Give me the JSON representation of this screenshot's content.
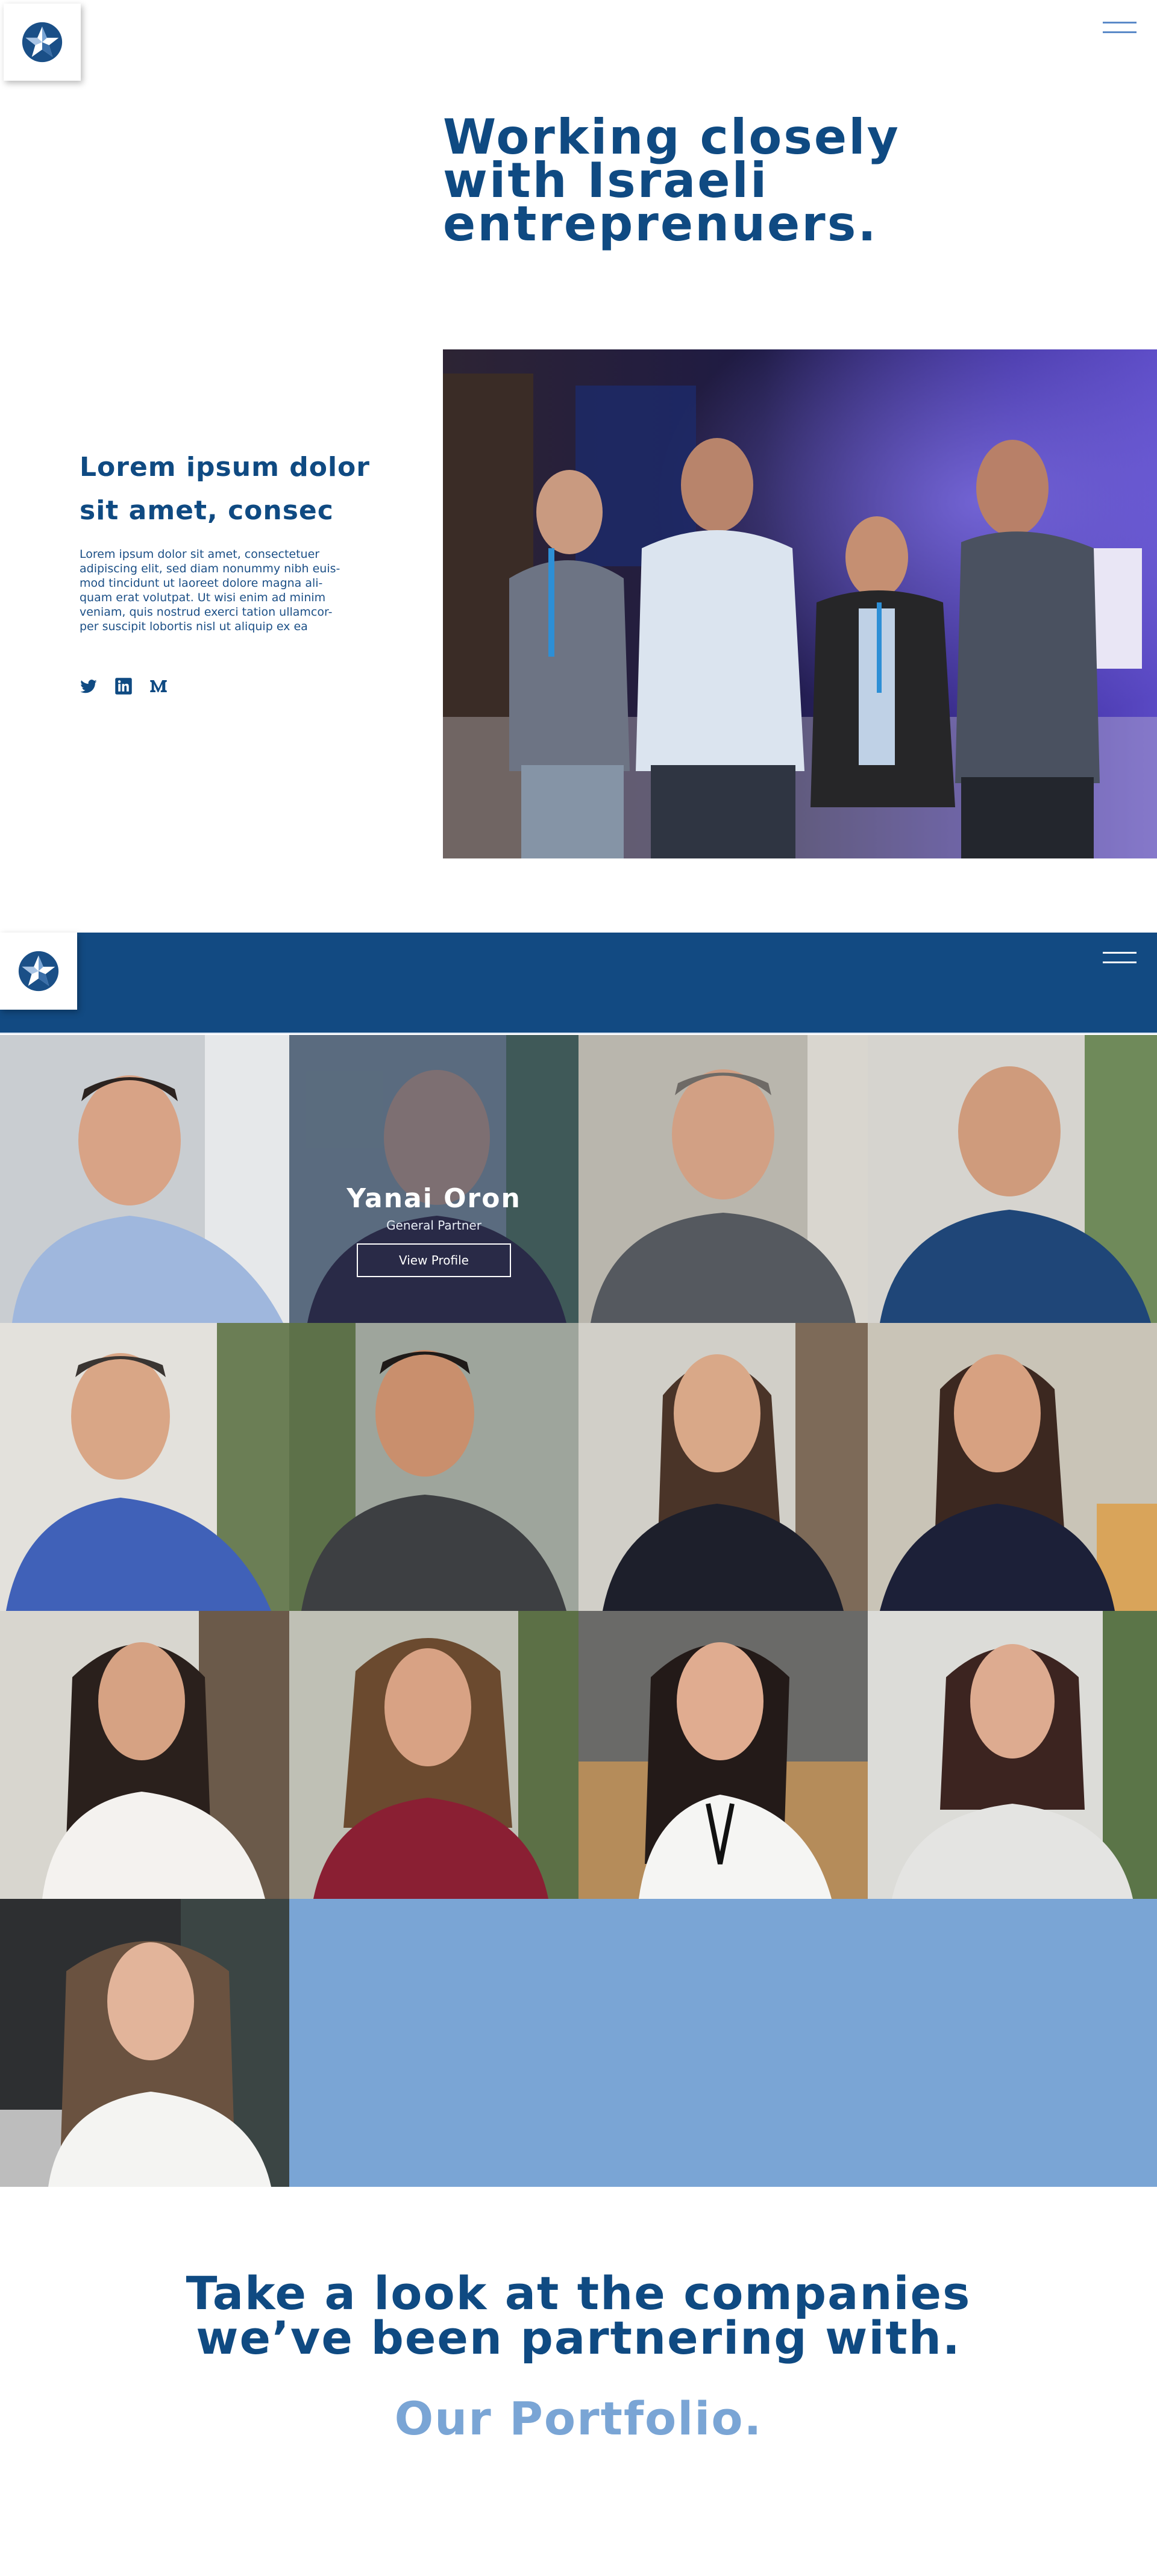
{
  "header": {
    "logo_label": "Logo",
    "menu_label": "Menu"
  },
  "hero": {
    "title_line1": "Working closely",
    "title_line2": "with Israeli",
    "title_line3": "entreprenuers."
  },
  "about": {
    "heading_line1": "Lorem ipsum dolor",
    "heading_line2": "sit amet, consec",
    "body_lines": [
      "Lorem ipsum dolor sit amet, consectetuer",
      "adipiscing elit, sed diam nonummy nibh euis-",
      "mod tincidunt ut laoreet dolore magna ali-",
      "quam erat volutpat. Ut wisi enim ad minim",
      "veniam, quis nostrud exerci tation ullamcor-",
      "per suscipit lobortis nisl ut aliquip ex ea"
    ],
    "social": [
      "twitter-icon",
      "linkedin-icon",
      "medium-icon"
    ]
  },
  "team": {
    "hovered_member": {
      "name": "Yanai Oron",
      "role": "General Partner",
      "button_label": "View Profile"
    }
  },
  "cta": {
    "title_line1": "Take a look at the companies",
    "title_line2": "we’ve been partnering with.",
    "link_label": "Our Portfolio."
  },
  "colors": {
    "brand_navy": "#0f4a82",
    "band_navy": "#124a82",
    "light_blue": "#7aa5d5",
    "accent_blue": "#5b8ac8"
  }
}
